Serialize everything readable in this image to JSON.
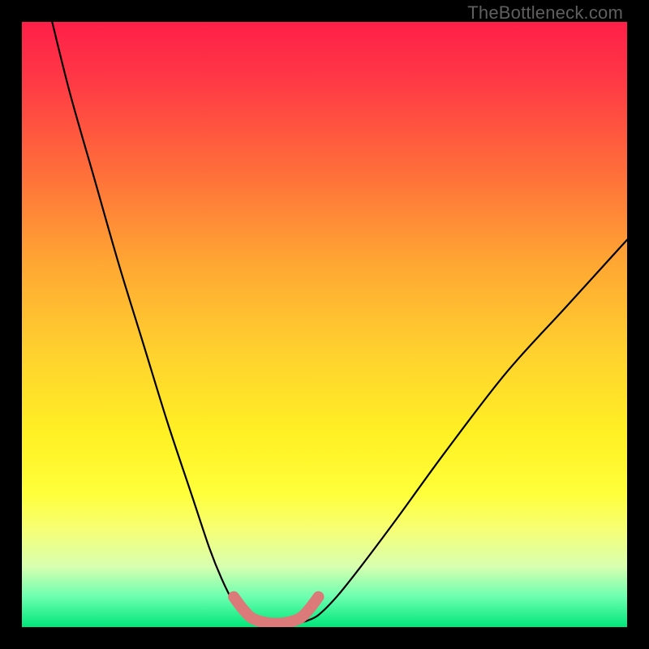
{
  "watermark": "TheBottleneck.com",
  "colors": {
    "frame": "#000000",
    "curve_stroke": "#000000",
    "marker_fill": "#db7a78",
    "marker_stroke": "#db7a78"
  },
  "chart_data": {
    "type": "line",
    "title": "",
    "xlabel": "",
    "ylabel": "",
    "xlim": [
      0,
      100
    ],
    "ylim": [
      0,
      100
    ],
    "grid": false,
    "legend": false,
    "annotations": [],
    "series": [
      {
        "name": "left-branch",
        "x": [
          5,
          8,
          12,
          16,
          20,
          24,
          28,
          31,
          33,
          35,
          36.5,
          37.5
        ],
        "y": [
          100,
          88,
          74,
          60,
          47,
          34,
          22,
          13,
          8,
          4,
          2,
          1
        ]
      },
      {
        "name": "right-branch",
        "x": [
          47,
          49,
          52,
          56,
          62,
          70,
          80,
          90,
          100
        ],
        "y": [
          1,
          2,
          5,
          10,
          18,
          29,
          42,
          53,
          64
        ]
      },
      {
        "name": "valley-floor",
        "x": [
          37.5,
          39,
          41,
          43,
          45,
          47
        ],
        "y": [
          1,
          0.5,
          0.3,
          0.3,
          0.5,
          1
        ]
      }
    ],
    "markers": {
      "name": "valley-markers",
      "x": [
        35,
        36.5,
        38,
        40,
        42,
        44,
        46,
        47.5,
        49
      ],
      "y": [
        5,
        3,
        1.5,
        0.8,
        0.6,
        0.8,
        1.5,
        3,
        5
      ],
      "size": [
        10,
        12,
        14,
        14,
        14,
        14,
        14,
        12,
        10
      ]
    }
  }
}
